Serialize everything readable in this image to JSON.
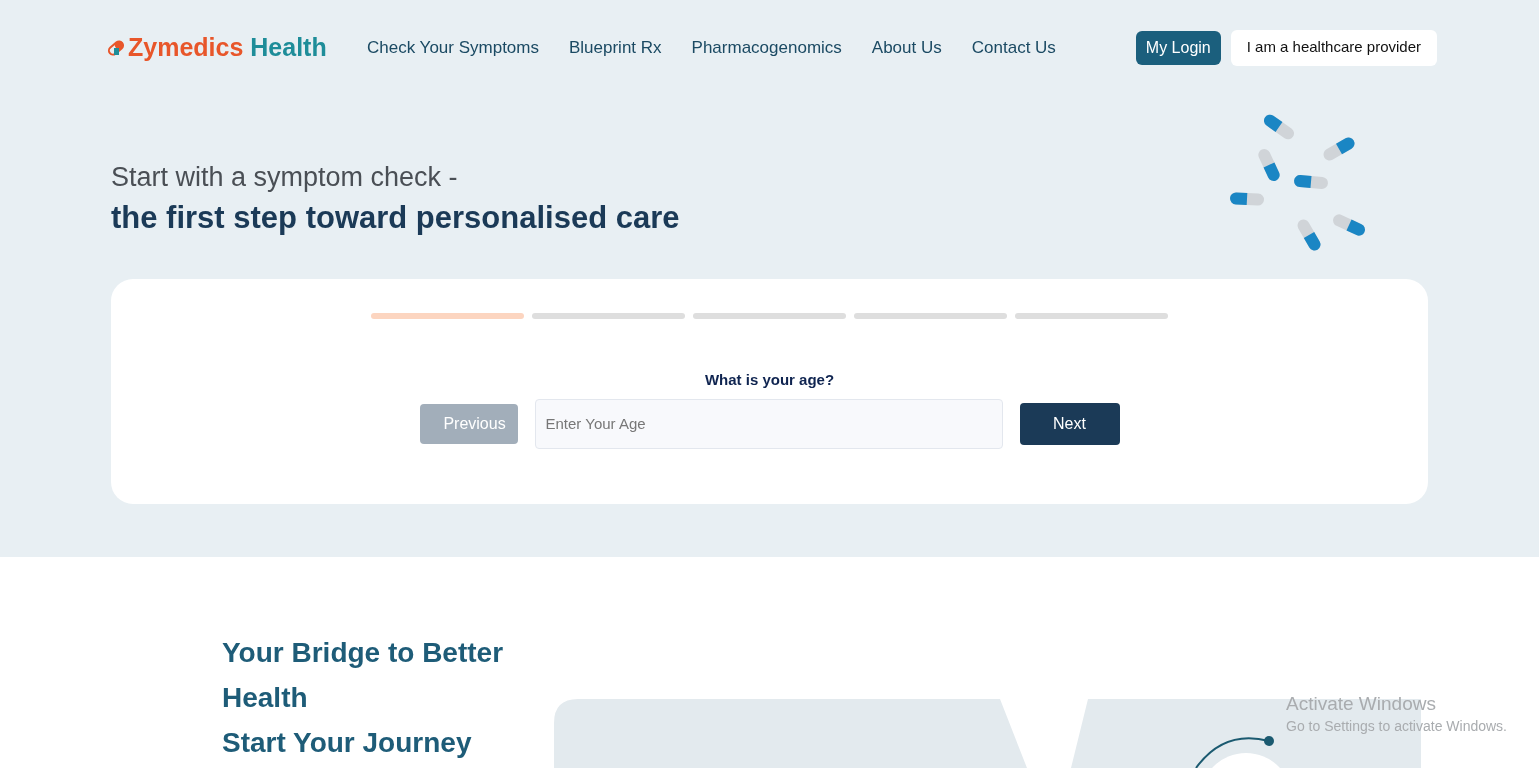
{
  "logo": {
    "brand": "Zymedics",
    "suffix": "Health"
  },
  "nav": [
    "Check Your Symptoms",
    "Blueprint Rx",
    "Pharmacogenomics",
    "About Us",
    "Contact Us"
  ],
  "header_buttons": [
    {
      "label": "My Login",
      "kind": "primary"
    },
    {
      "label": "I am a healthcare provider",
      "kind": "secondary"
    }
  ],
  "hero": {
    "subtitle": "Start with a symptom check -",
    "title": "the first step toward personalised care"
  },
  "steps": [
    {
      "selected": true
    },
    {
      "selected": false
    },
    {
      "selected": false
    },
    {
      "selected": false
    },
    {
      "selected": false
    }
  ],
  "question": {
    "label": "What is your age?",
    "placeholder": "Enter Your Age",
    "previous": {
      "label": "Previous",
      "disabled": true
    },
    "next": {
      "label": "Next",
      "disabled": false
    }
  },
  "section": {
    "lines": [
      "Your Bridge to Better",
      "Health",
      "Start Your Journey"
    ]
  },
  "os_notice": {
    "title": "Activate Windows",
    "text": "Go to Settings to activate Windows."
  }
}
